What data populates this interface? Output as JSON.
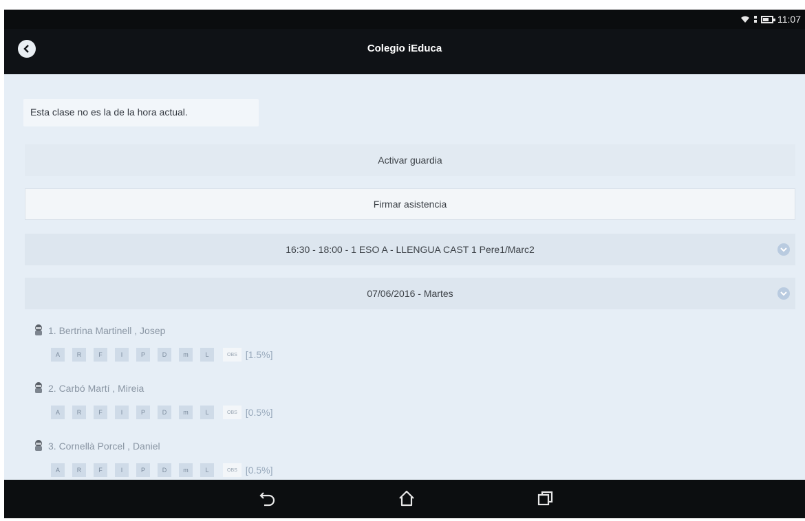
{
  "status_bar": {
    "time": "11:07",
    "icons": [
      "wifi-icon",
      "signal-icon",
      "battery-icon"
    ]
  },
  "app_bar": {
    "title": "Colegio iEduca",
    "back_icon": "back-arrow-icon"
  },
  "notice": "Esta clase no es la de la hora actual.",
  "actions": {
    "guardia": "Activar guardia",
    "firmar": "Firmar asistencia"
  },
  "selectors": {
    "clase": "16:30 - 18:00 - 1 ESO A - LLENGUA CAST 1 Pere1/Marc2",
    "fecha": "07/06/2016 - Martes"
  },
  "attendance_codes": [
    "A",
    "R",
    "F",
    "I",
    "P",
    "D",
    "m",
    "L"
  ],
  "obs_label": "OBS",
  "students": [
    {
      "name": "1. Bertrina Martinell , Josep",
      "pct": "[1.5%]"
    },
    {
      "name": "2. Carbó Martí , Mireia",
      "pct": "[0.5%]"
    },
    {
      "name": "3. Cornellà Porcel , Daniel",
      "pct": "[0.5%]"
    }
  ],
  "nav_icons": [
    "back-icon",
    "home-icon",
    "recent-apps-icon"
  ],
  "colors": {
    "content_bg": "#e6eef6",
    "appbar_bg": "#0f1216",
    "code_bg": "#cfdbe8",
    "chevron": "#b9cbe0"
  }
}
